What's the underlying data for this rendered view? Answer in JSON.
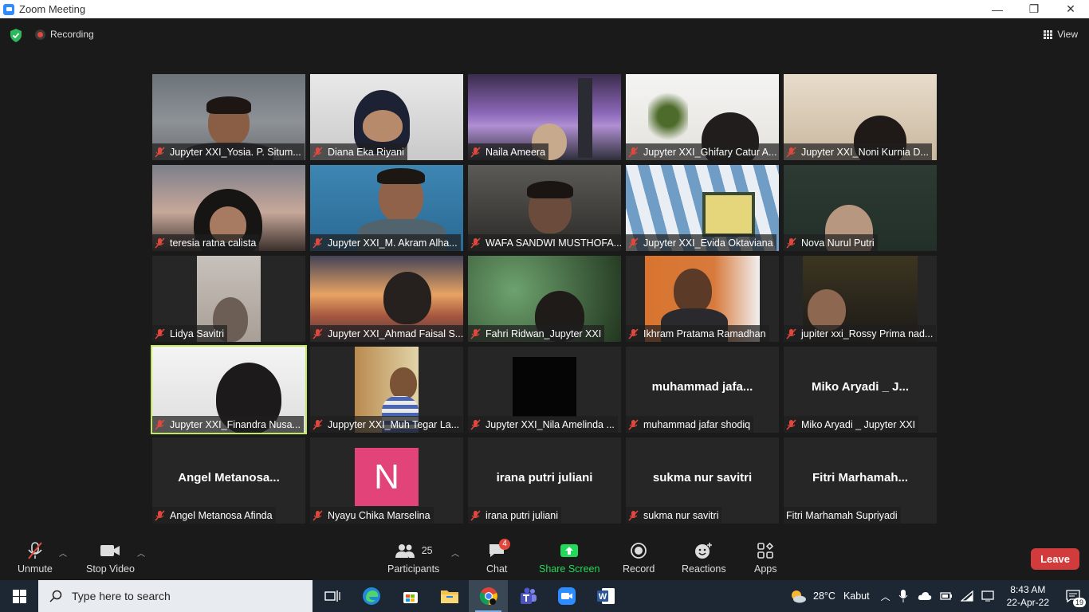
{
  "window": {
    "title": "Zoom Meeting",
    "minimize": "—",
    "restore": "❐",
    "close": "✕"
  },
  "status": {
    "recording": "Recording",
    "view": "View"
  },
  "participants": [
    {
      "name": "Jupyter XXI_Yosia. P. Situm...",
      "type": "video"
    },
    {
      "name": "Diana Eka Riyani",
      "type": "video"
    },
    {
      "name": "Naila Ameera",
      "type": "video"
    },
    {
      "name": "Jupyter XXI_Ghifary Catur A...",
      "type": "video"
    },
    {
      "name": "Jupyter XXI_Noni Kurnia D...",
      "type": "video"
    },
    {
      "name": "teresia ratna calista",
      "type": "video"
    },
    {
      "name": "Jupyter XXI_M. Akram Alha...",
      "type": "video"
    },
    {
      "name": "WAFA SANDWI MUSTHOFA...",
      "type": "video"
    },
    {
      "name": "Jupyter XXI_Evida Oktaviana",
      "type": "video"
    },
    {
      "name": "Nova Nurul Putri",
      "type": "video"
    },
    {
      "name": "Lidya Savitri",
      "type": "video"
    },
    {
      "name": "Jupyter XXI_Ahmad Faisal S...",
      "type": "video"
    },
    {
      "name": "Fahri Ridwan_Jupyter XXI",
      "type": "video"
    },
    {
      "name": "Ikhram Pratama Ramadhan",
      "type": "video"
    },
    {
      "name": "jupiter xxi_Rossy Prima nad...",
      "type": "video"
    },
    {
      "name": "Jupyter XXI_Finandra Nusa...",
      "type": "video"
    },
    {
      "name": "Juppyter XXI_Muh Tegar La...",
      "type": "video"
    },
    {
      "name": "Jupyter XXI_Nila Amelinda ...",
      "type": "video"
    },
    {
      "name": "muhammad jafar shodiq",
      "type": "name",
      "display": "muhammad  jafa..."
    },
    {
      "name": "Miko Aryadi _ Jupyter XXI",
      "type": "name",
      "display": "Miko Aryadi _ J..."
    },
    {
      "name": "Angel Metanosa Afinda",
      "type": "name",
      "display": "Angel  Metanosa..."
    },
    {
      "name": "Nyayu Chika Marselina",
      "type": "avatar",
      "display": "N"
    },
    {
      "name": "irana putri juliani",
      "type": "name",
      "display": "irana putri juliani"
    },
    {
      "name": "sukma nur savitri",
      "type": "name",
      "display": "sukma nur savitri"
    },
    {
      "name": "Fitri Marhamah Supriyadi",
      "type": "name",
      "display": "Fitri  Marhamah..."
    }
  ],
  "toolbar": {
    "unmute": "Unmute",
    "stop_video": "Stop Video",
    "participants": "Participants",
    "participants_count": "25",
    "chat": "Chat",
    "chat_badge": "4",
    "share_screen": "Share Screen",
    "record": "Record",
    "reactions": "Reactions",
    "apps": "Apps",
    "leave": "Leave"
  },
  "taskbar": {
    "search_placeholder": "Type here to search",
    "weather_temp": "28°C",
    "weather_desc": "Kabut",
    "time": "8:43 AM",
    "date": "22-Apr-22",
    "notifications": "19"
  },
  "colors": {
    "active_speaker": "#c3e85b",
    "share_green": "#23d959",
    "leave_red": "#d13b3b",
    "avatar_pink": "#e2447a"
  }
}
